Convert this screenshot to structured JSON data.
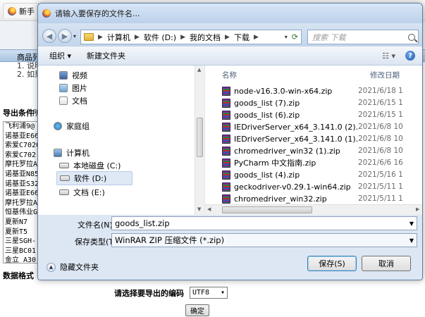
{
  "browser": {
    "tabs": [
      {
        "label": "新手"
      },
      {
        "label": ""
      }
    ]
  },
  "background_page": {
    "menu_item": "商品列",
    "notes": [
      "1. 说明",
      "2. 如果"
    ],
    "export_label": "导出条件",
    "export_label_suffix": "所",
    "list_items": [
      "飞利浦9@",
      "诺基亚E66",
      "索爱C702G",
      "索爱C702",
      "摩托罗拉A",
      "诺基亚N85",
      "诺基亚S32",
      "诺基亚E66",
      "摩托罗拉A",
      "恒基伟业G",
      "夏新N7",
      "夏新T5",
      "三星SGH-",
      "三星BC01",
      "金立 A30"
    ],
    "data_format_label": "数据格式",
    "encoding_label": "请选择要导出的编码",
    "encoding_value": "UTF8",
    "confirm_button": "确定"
  },
  "dialog": {
    "title": "请输入要保存的文件名...",
    "breadcrumb": [
      "计算机",
      "软件 (D:)",
      "我的文档",
      "下载"
    ],
    "search_placeholder": "搜索 下载",
    "toolbar": {
      "organize": "组织 ▾",
      "new_folder": "新建文件夹",
      "view_icon": "☷ ▾",
      "help": "?"
    },
    "nav_items": [
      {
        "label": "视频",
        "icon": "video-icon"
      },
      {
        "label": "图片",
        "icon": "pictures-icon"
      },
      {
        "label": "文档",
        "icon": "documents-icon"
      },
      {
        "label": "家庭组",
        "icon": "homegroup-icon"
      },
      {
        "label": "计算机",
        "icon": "computer-icon"
      },
      {
        "label": "本地磁盘 (C:)",
        "icon": "drive-icon"
      },
      {
        "label": "软件 (D:)",
        "icon": "drive-icon"
      },
      {
        "label": "文档 (E:)",
        "icon": "drive-icon"
      }
    ],
    "columns": {
      "name": "名称",
      "modified": "修改日期"
    },
    "files": [
      {
        "name": "node-v16.3.0-win-x64.zip",
        "date": "2021/6/18 1"
      },
      {
        "name": "goods_list (7).zip",
        "date": "2021/6/15 1"
      },
      {
        "name": "goods_list (6).zip",
        "date": "2021/6/15 1"
      },
      {
        "name": "IEDriverServer_x64_3.141.0 (2).zip",
        "date": "2021/6/8 10"
      },
      {
        "name": "IEDriverServer_x64_3.141.0 (1).zip",
        "date": "2021/6/8 10"
      },
      {
        "name": "chromedriver_win32 (1).zip",
        "date": "2021/6/8 10"
      },
      {
        "name": "PyCharm 中文指南.zip",
        "date": "2021/6/6 16"
      },
      {
        "name": "goods_list (4).zip",
        "date": "2021/5/16 1"
      },
      {
        "name": "geckodriver-v0.29.1-win64.zip",
        "date": "2021/5/11 1"
      },
      {
        "name": "chromedriver_win32.zip",
        "date": "2021/5/11 1"
      }
    ],
    "filename_label": "文件名(N):",
    "filename_value": "goods_list.zip",
    "filetype_label": "保存类型(T):",
    "filetype_value": "WinRAR ZIP 压缩文件 (*.zip)",
    "hide_folders": "隐藏文件夹",
    "save_button": "保存(S)",
    "cancel_button": "取消"
  }
}
